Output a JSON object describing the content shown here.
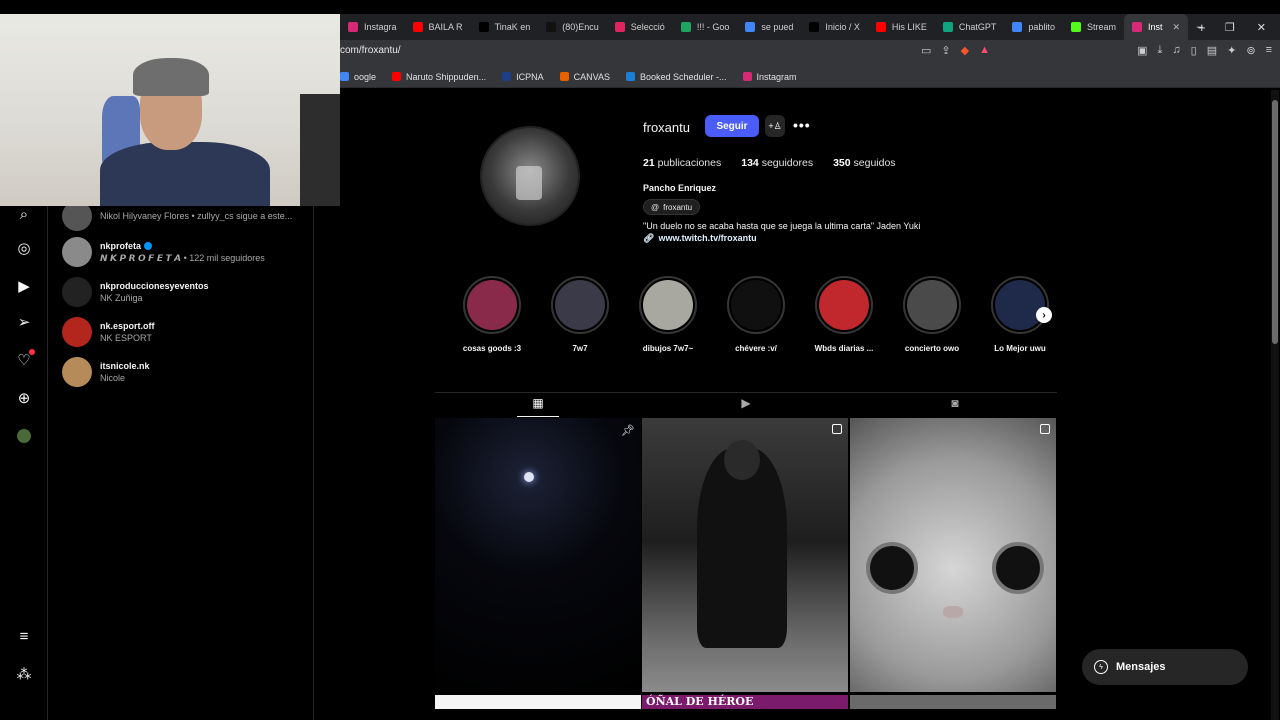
{
  "browser": {
    "tabs": [
      {
        "label": "Instagra",
        "color": "#d62976"
      },
      {
        "label": "BAILA R",
        "color": "#ff0000"
      },
      {
        "label": "TinaK en",
        "color": "#000000"
      },
      {
        "label": "(80)Encu",
        "color": "#111111"
      },
      {
        "label": "Selecció",
        "color": "#e0245e"
      },
      {
        "label": "!!! - Goo",
        "color": "#1fa463"
      },
      {
        "label": "se pued",
        "color": "#4285f4"
      },
      {
        "label": "Inicio / X",
        "color": "#000000"
      },
      {
        "label": "His LIKE",
        "color": "#ff0000"
      },
      {
        "label": "ChatGPT",
        "color": "#10a37f"
      },
      {
        "label": "pablito",
        "color": "#4285f4"
      },
      {
        "label": "Stream",
        "color": "#53fc18"
      },
      {
        "label": "Inst",
        "color": "#d62976",
        "active": true
      }
    ],
    "new_tab": "+",
    "url": "com/froxantu/",
    "bookmarks": [
      {
        "label": "oogle",
        "color": "#4285f4"
      },
      {
        "label": "Naruto Shippuden...",
        "color": "#ff0000"
      },
      {
        "label": "ICPNA",
        "color": "#1d3f8a"
      },
      {
        "label": "CANVAS",
        "color": "#e66000"
      },
      {
        "label": "Booked Scheduler -...",
        "color": "#1d7ed6"
      },
      {
        "label": "Instagram",
        "color": "#d62976"
      }
    ]
  },
  "search_results": [
    {
      "user": "Nikol Hilyvaney Flores",
      "sub": "Nikol Hilyvaney Flores • zullyy_cs sigue a este...",
      "verified": false,
      "avatar": "#555555",
      "show_user": false
    },
    {
      "user": "nkprofeta",
      "sub": "𝙉 𝙆 𝙋 𝙍 𝙊 𝙁 𝙀 𝙏 𝘼 • 122 mil seguidores",
      "verified": true,
      "avatar": "#8a8a8a"
    },
    {
      "user": "nkproduccionesyeventos",
      "sub": "NK Zuñiga",
      "verified": false,
      "avatar": "#222222"
    },
    {
      "user": "nk.esport.off",
      "sub": "NK ESPORT",
      "verified": false,
      "avatar": "#b3261e"
    },
    {
      "user": "itsnicole.nk",
      "sub": "Nicole",
      "verified": false,
      "avatar": "#b58b5a"
    }
  ],
  "profile": {
    "username": "froxantu",
    "follow_label": "Seguir",
    "more": "•••",
    "posts_count": "21",
    "posts_label": "publicaciones",
    "followers_count": "134",
    "followers_label": "seguidores",
    "following_count": "350",
    "following_label": "seguidos",
    "full_name": "Pancho Enriquez",
    "threads_handle": "froxantu",
    "bio": "\"Un duelo no se acaba hasta que se juega la ultima carta\" Jaden Yuki",
    "link": "www.twitch.tv/froxantu"
  },
  "highlights": [
    {
      "label": "cosas goods :3",
      "color": "#8a2a4a"
    },
    {
      "label": "7w7",
      "color": "#3a3a48"
    },
    {
      "label": "dibujos 7w7~",
      "color": "#a8a8a0"
    },
    {
      "label": "chévere :v/",
      "color": "#101010"
    },
    {
      "label": "Wbds diarias ...",
      "color": "#c0282d"
    },
    {
      "label": "concierto owo",
      "color": "#4a4a4a"
    },
    {
      "label": "Lo Mejor uwu",
      "color": "#1f2a4a"
    }
  ],
  "post_row2_text": "ÓÑAL DE HÉROE",
  "messages_label": "Mensajes",
  "icons": {
    "search": "search-icon",
    "explore": "compass-icon",
    "reels": "reels-icon",
    "direct": "paper-plane-icon",
    "notifications": "heart-icon",
    "create": "plus-icon",
    "menu": "hamburger-icon",
    "threads": "threads-icon"
  }
}
